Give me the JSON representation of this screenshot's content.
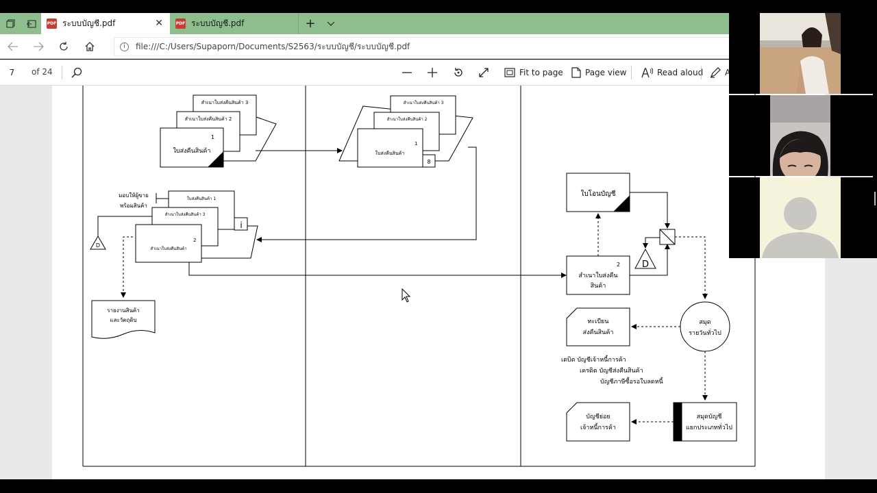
{
  "browser": {
    "tabs": [
      {
        "title": "ระบบบัญชี.pdf",
        "active": true
      },
      {
        "title": "ระบบบัญชี.pdf",
        "active": false
      }
    ],
    "address": "file:///C:/Users/Supaporn/Documents/S2563/ระบบบัญชี/ระบบบัญชี.pdf"
  },
  "pdf_toolbar": {
    "page_number": "7",
    "page_total": "of 24",
    "fit_to_page": "Fit to page",
    "page_view": "Page view",
    "read_aloud": "Read aloud",
    "draw_partial": "A"
  },
  "flowchart": {
    "top_left_copy3": "สำเนาใบส่งคืนสินค้า 3",
    "top_left_copy2": "สำเนาใบส่งคืนสินค้า 2",
    "top_left_original_num": "1",
    "top_left_original": "ใบส่งคืนสินค้า",
    "mid_copy3": "สำเนาใบส่งคืนสินค้า 3",
    "mid_copy2": "สำเนาใบส่งคืนสินค้า 2",
    "mid_original_num": "1",
    "mid_original": "ใบส่งคืนสินค้า",
    "mid_connector": "8",
    "left2_copy1": "ใบส่งคืนสินค้า 1",
    "left2_copy3": "สำเนาใบส่งคืนสินค้า 3",
    "left2_copy2_num": "2",
    "left2_copy2": "สำเนาใบส่งคืนสินค้า",
    "annotation_line1": "มอบให้ผู้ขาย",
    "annotation_line2": "พร้อมสินค้า",
    "connector_i": "i",
    "file_d_small": "D",
    "report_line1": "รายงานสินค้า",
    "report_line2": "และวัตถุดิบ",
    "transfer_voucher": "ใบโอนบัญชี",
    "copy2_num": "2",
    "copy2_line1": "สำเนาใบส่งคืน",
    "copy2_line2": "สินค้า",
    "file_d_big": "D",
    "register_line1": "ทะเบียน",
    "register_line2": "ส่งคืนสินค้า",
    "journal_line1": "สมุด",
    "journal_line2": "รายวันทั่วไป",
    "entry_line1": "เดบิต บัญชีเจ้าหนี้การค้า",
    "entry_line2": "เครดิต บัญชีส่งคืนสินค้า",
    "entry_line3": "บัญชีภาษีซื้อรอใบลดหนี้",
    "ledger_line1": "สมุดบัญชี",
    "ledger_line2": "แยกประเภททั่วไป",
    "subledger_line1": "บัญชีย่อย",
    "subledger_line2": "เจ้าหนี้การค้า"
  },
  "participants": [
    {
      "name": "participant-beach-video"
    },
    {
      "name": "participant-webcam-video"
    },
    {
      "name": "participant-no-video"
    }
  ]
}
